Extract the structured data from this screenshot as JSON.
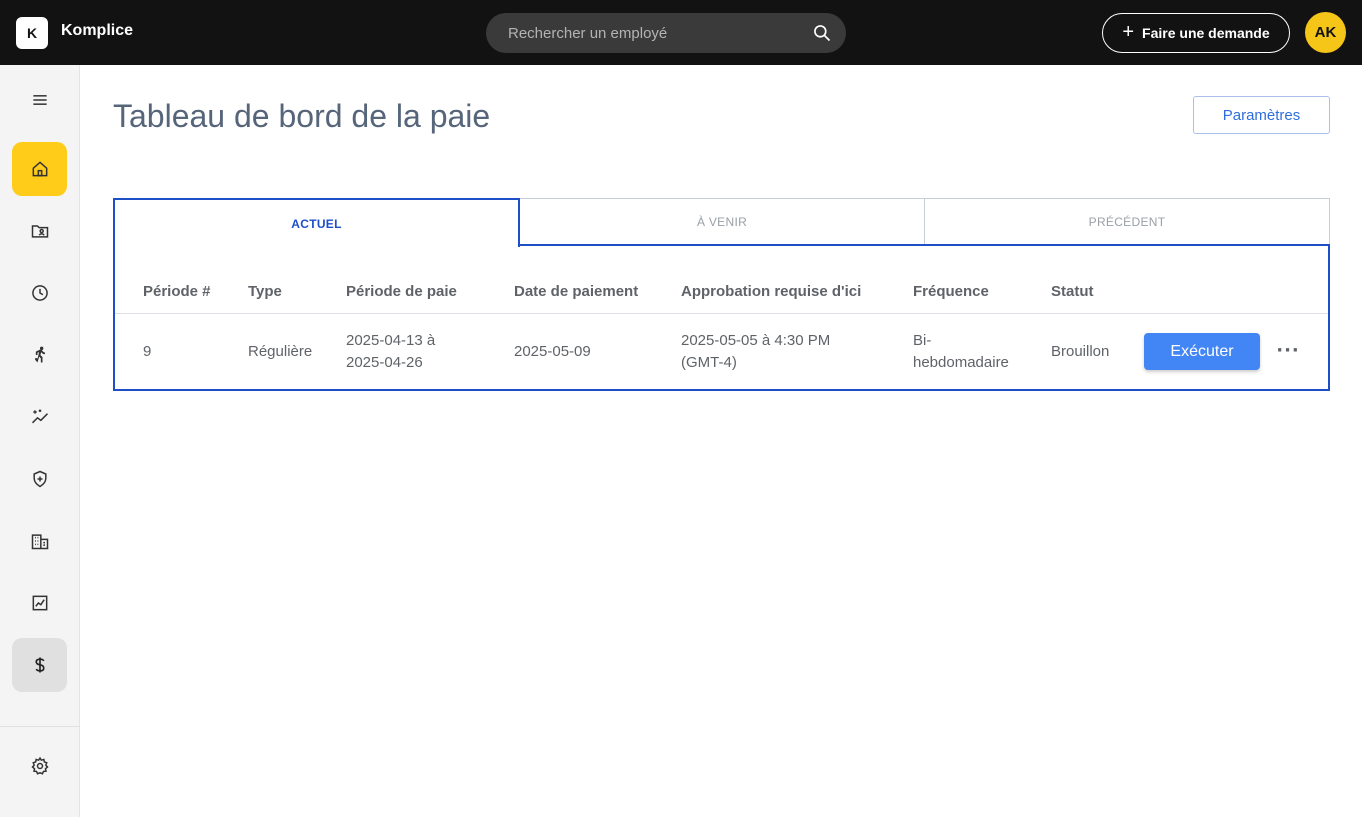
{
  "topbar": {
    "logo_letter": "K",
    "app_name": "Komplice",
    "search_placeholder": "Rechercher un employé",
    "request_button": "Faire une demande",
    "avatar_initials": "AK"
  },
  "sidebar": {
    "items": [
      {
        "icon": "menu-icon"
      },
      {
        "icon": "home-icon",
        "state": "active"
      },
      {
        "icon": "folder-user-icon"
      },
      {
        "icon": "clock-icon"
      },
      {
        "icon": "person-running-icon"
      },
      {
        "icon": "sparkle-chart-icon"
      },
      {
        "icon": "shield-plus-icon"
      },
      {
        "icon": "building-icon"
      },
      {
        "icon": "line-chart-icon"
      },
      {
        "icon": "dollar-icon",
        "state": "selected"
      },
      {
        "icon": "gear-icon"
      }
    ]
  },
  "page": {
    "title": "Tableau de bord de la paie",
    "params_button": "Paramètres"
  },
  "tabs": [
    {
      "label": "ACTUEL",
      "active": true
    },
    {
      "label": "À VENIR",
      "active": false
    },
    {
      "label": "PRÉCÉDENT",
      "active": false
    }
  ],
  "table": {
    "headers": [
      "Période #",
      "Type",
      "Période de paie",
      "Date de paiement",
      "Approbation requise d'ici",
      "Fréquence",
      "Statut"
    ],
    "rows": [
      {
        "period": "9",
        "type": "Régulière",
        "pay_period_start": "2025-04-13 à",
        "pay_period_end": "2025-04-26",
        "payment_date": "2025-05-09",
        "approval_line1": "2025-05-05 à 4:30 PM",
        "approval_line2": "(GMT-4)",
        "frequency_line1": "Bi-",
        "frequency_line2": "hebdomadaire",
        "status": "Brouillon",
        "action": "Exécuter",
        "more": "···"
      }
    ]
  },
  "colors": {
    "topbar": "#121212",
    "accent_yellow": "#ffcc1a",
    "tab_blue": "#1e4fc7",
    "button_blue": "#4285f4"
  }
}
